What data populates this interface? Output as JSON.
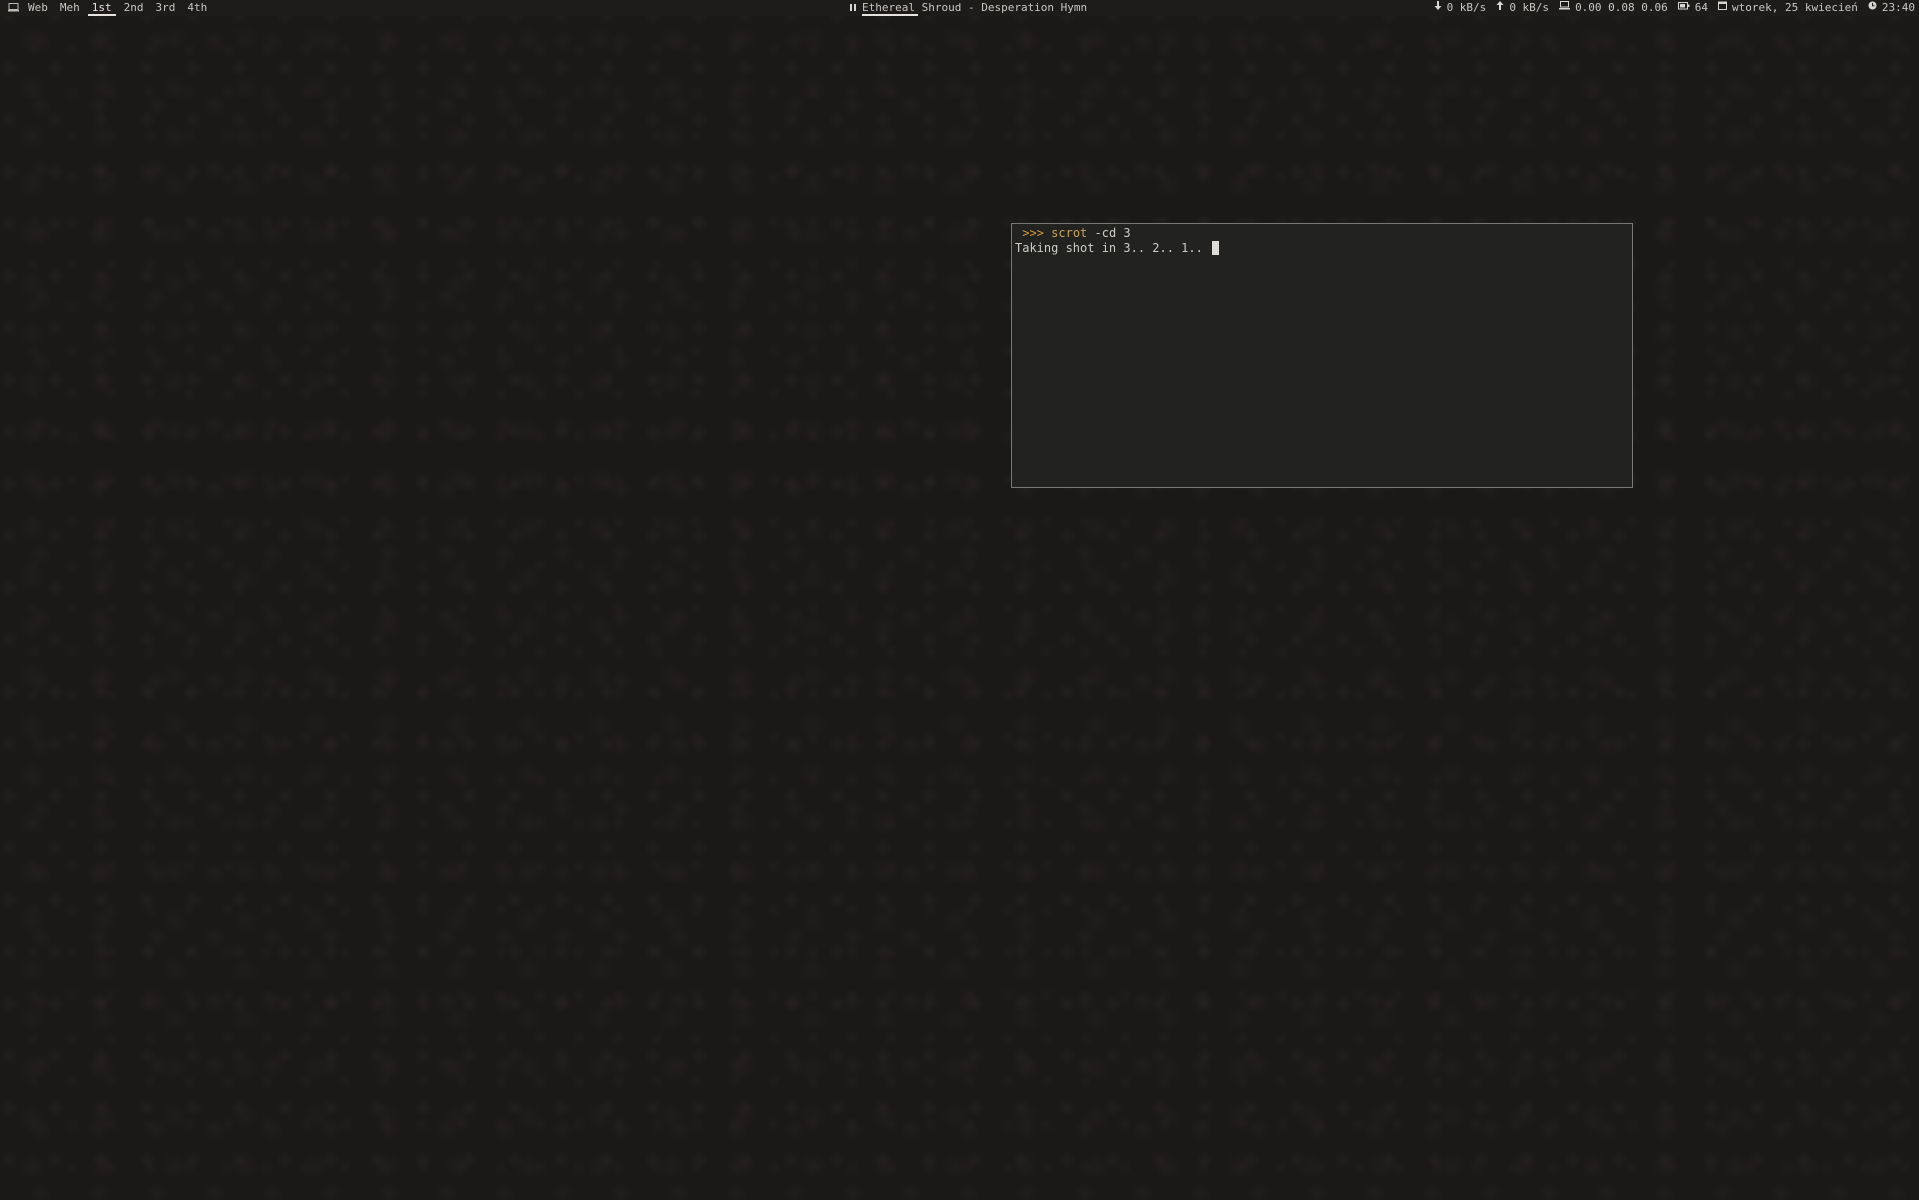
{
  "panel": {
    "layout_icon": "monitor-icon",
    "tags": [
      {
        "label": "Web",
        "active": false
      },
      {
        "label": "Meh",
        "active": false
      },
      {
        "label": "1st",
        "active": true
      },
      {
        "label": "2nd",
        "active": false
      },
      {
        "label": "3rd",
        "active": false
      },
      {
        "label": "4th",
        "active": false
      }
    ],
    "now_playing": {
      "state_icon": "pause-icon",
      "text": "Ethereal Shroud - Desperation Hymn"
    },
    "status": {
      "download": "0 kB/s",
      "upload": "0 kB/s",
      "load": "0.00 0.08 0.06",
      "battery": "64",
      "date": "wtorek, 25 kwiecień",
      "time": "23:40"
    }
  },
  "terminal": {
    "prompt": ">>>",
    "command": "scrot",
    "args": " -cd 3",
    "output": "Taking shot in 3.. 2.. 1.. "
  },
  "colors": {
    "background": "#1b1918",
    "panel": "#1d1c1b",
    "terminal_bg": "#222221",
    "prompt": "#d29a3c",
    "command": "#c9a45b"
  }
}
